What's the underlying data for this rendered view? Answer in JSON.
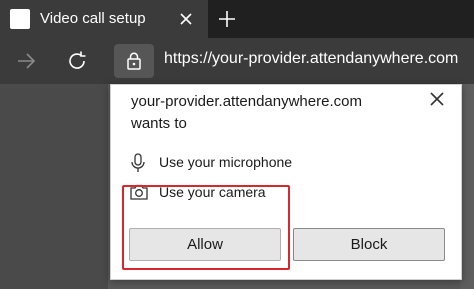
{
  "tab": {
    "title": "Video call setup",
    "favicon_icon": "page-icon",
    "close_icon": "close-icon"
  },
  "toolbar": {
    "newtab_icon": "plus-icon",
    "back_icon": "arrow-right-icon",
    "reload_icon": "reload-icon",
    "site_info_icon": "lock-icon",
    "url": "https://your-provider.attendanywhere.com"
  },
  "popup": {
    "origin": "your-provider.attendanywhere.com",
    "wants": "wants to",
    "close_icon": "close-icon",
    "permissions": [
      {
        "icon": "microphone-icon",
        "label": "Use your microphone"
      },
      {
        "icon": "camera-icon",
        "label": "Use your camera"
      }
    ],
    "allow_label": "Allow",
    "block_label": "Block",
    "highlight_color": "#d9272e"
  },
  "colors": {
    "tabstrip": "#202020",
    "toolbar": "#3b3b3b",
    "popup_bg": "#ffffff",
    "button_bg": "#e6e6e6"
  }
}
